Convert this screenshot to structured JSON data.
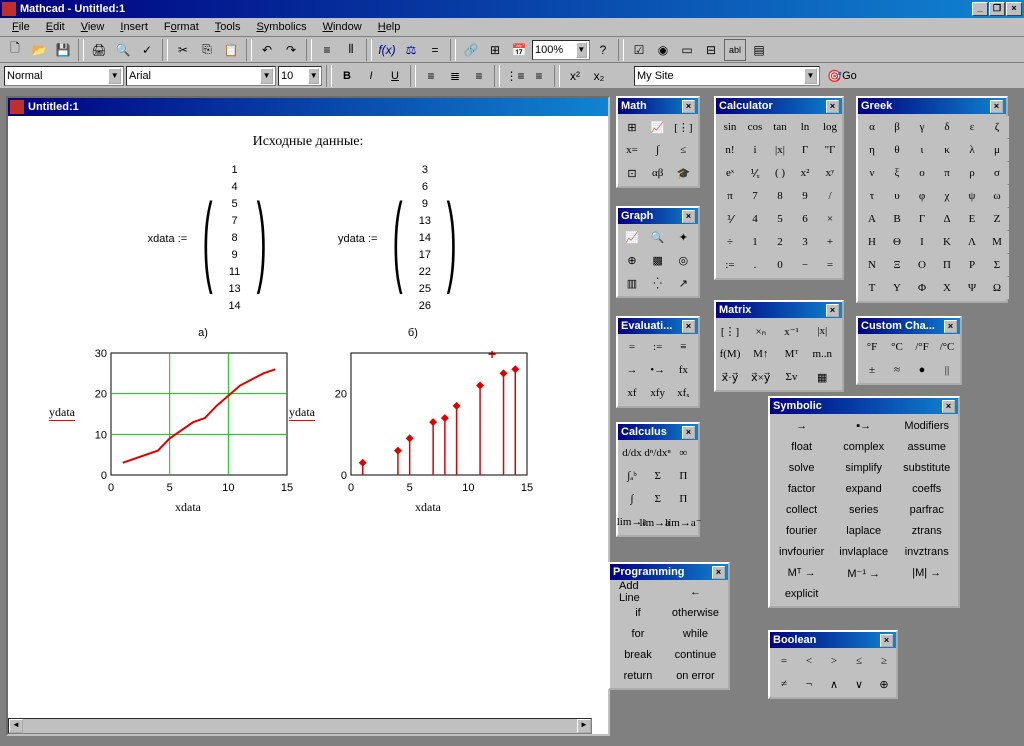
{
  "app": {
    "title": "Mathcad - Untitled:1"
  },
  "menu": {
    "file": "File",
    "edit": "Edit",
    "view": "View",
    "insert": "Insert",
    "format": "Format",
    "tools": "Tools",
    "symbolics": "Symbolics",
    "window": "Window",
    "help": "Help"
  },
  "toolbar2": {
    "zoom": "100%"
  },
  "formatbar": {
    "style": "Normal",
    "font": "Arial",
    "size": "10",
    "mysite": "My Site",
    "go": "Go"
  },
  "doc": {
    "title": "Untitled:1",
    "heading": "Исходные данные:",
    "xname": "xdata :=",
    "yname": "ydata :=",
    "label_a": "a)",
    "label_b": "б)"
  },
  "xdata": [
    1,
    4,
    5,
    7,
    8,
    9,
    11,
    13,
    14
  ],
  "ydata": [
    3,
    6,
    9,
    13,
    14,
    17,
    22,
    25,
    26
  ],
  "palettes": {
    "math": "Math",
    "graph": "Graph",
    "evaluation": "Evaluati...",
    "calculus": "Calculus",
    "programming": "Programming",
    "calculator": "Calculator",
    "matrix": "Matrix",
    "symbolic": "Symbolic",
    "boolean": "Boolean",
    "greek": "Greek",
    "custom": "Custom Cha..."
  },
  "calculator": {
    "r1": [
      "sin",
      "cos",
      "tan",
      "ln",
      "log"
    ],
    "r2": [
      "n!",
      "i",
      "|x|",
      "Γ",
      "\"Γ"
    ],
    "r3": [
      "eˣ",
      "⅟ₓ",
      "( )",
      "x²",
      "xʸ"
    ],
    "r4": [
      "π",
      "7",
      "8",
      "9",
      "/"
    ],
    "r5": [
      "⅟",
      "4",
      "5",
      "6",
      "×"
    ],
    "r6": [
      "÷",
      "1",
      "2",
      "3",
      "+"
    ],
    "r7": [
      ":=",
      ".",
      "0",
      "−",
      "="
    ]
  },
  "matrix": [
    "[⋮]",
    "×ₙ",
    "x⁻¹",
    "|x|",
    "f(M)",
    "M↑",
    "Mᵀ",
    "m..n",
    "x⃗·y⃗",
    "x⃗×y⃗",
    "Σv",
    "▦"
  ],
  "evaluation": [
    "=",
    ":=",
    "≡",
    "→",
    "•→",
    "fx",
    "xf",
    "xfy",
    "xfₓ"
  ],
  "calculus": [
    "d/dx",
    "dⁿ/dxⁿ",
    "∞",
    "∫ₐᵇ",
    "Σ",
    "Π",
    "∫",
    "Σ",
    "Π",
    "lim→a",
    "lim→a⁺",
    "lim→a⁻"
  ],
  "programming": {
    "addline": "Add Line",
    "arrow": "←",
    "if": "if",
    "otherwise": "otherwise",
    "for": "for",
    "while": "while",
    "break": "break",
    "continue": "continue",
    "return": "return",
    "onerror": "on error"
  },
  "symbolic": {
    "r1": [
      "→",
      "▪→",
      "Modifiers"
    ],
    "r2": [
      "float",
      "complex",
      "assume"
    ],
    "r3": [
      "solve",
      "simplify",
      "substitute"
    ],
    "r4": [
      "factor",
      "expand",
      "coeffs"
    ],
    "r5": [
      "collect",
      "series",
      "parfrac"
    ],
    "r6": [
      "fourier",
      "laplace",
      "ztrans"
    ],
    "r7": [
      "invfourier",
      "invlaplace",
      "invztrans"
    ],
    "r8": [
      "Mᵀ →",
      "M⁻¹ →",
      "|M| →"
    ],
    "r9": [
      "explicit",
      "",
      ""
    ]
  },
  "boolean": [
    "=",
    "<",
    ">",
    "≤",
    "≥",
    "≠",
    "¬",
    "∧",
    "∨",
    "⊕"
  ],
  "greek_lower": [
    "α",
    "β",
    "γ",
    "δ",
    "ε",
    "ζ",
    "η",
    "θ",
    "ι",
    "κ",
    "λ",
    "μ",
    "ν",
    "ξ",
    "ο",
    "π",
    "ρ",
    "σ",
    "τ",
    "υ",
    "φ",
    "χ",
    "ψ",
    "ω"
  ],
  "greek_upper": [
    "Α",
    "Β",
    "Γ",
    "Δ",
    "Ε",
    "Ζ",
    "Η",
    "Θ",
    "Ι",
    "Κ",
    "Λ",
    "Μ",
    "Ν",
    "Ξ",
    "Ο",
    "Π",
    "Ρ",
    "Σ",
    "Τ",
    "Υ",
    "Φ",
    "Χ",
    "Ψ",
    "Ω"
  ],
  "custom": [
    "°F",
    "°C",
    "/°F",
    "/°C",
    "±",
    "≈",
    "●",
    "||"
  ],
  "chart_data": [
    {
      "type": "line",
      "x": [
        1,
        4,
        5,
        7,
        8,
        9,
        11,
        13,
        14
      ],
      "y": [
        3,
        6,
        9,
        13,
        14,
        17,
        22,
        25,
        26
      ],
      "xlabel": "xdata",
      "ylabel": "ydata",
      "xlim": [
        0,
        15
      ],
      "ylim": [
        0,
        30
      ],
      "xticks": [
        0,
        5,
        10,
        15
      ],
      "yticks": [
        0,
        10,
        20,
        30
      ],
      "grid": true,
      "color": "#e00000"
    },
    {
      "type": "stem",
      "x": [
        1,
        4,
        5,
        7,
        8,
        9,
        11,
        13,
        14
      ],
      "y": [
        3,
        6,
        9,
        13,
        14,
        17,
        22,
        25,
        26
      ],
      "xlabel": "xdata",
      "ylabel": "ydata",
      "xlim": [
        0,
        15
      ],
      "ylim": [
        0,
        30
      ],
      "xticks": [
        0,
        5,
        10,
        15
      ],
      "yticks": [
        0,
        20
      ],
      "color": "#e00000"
    }
  ]
}
